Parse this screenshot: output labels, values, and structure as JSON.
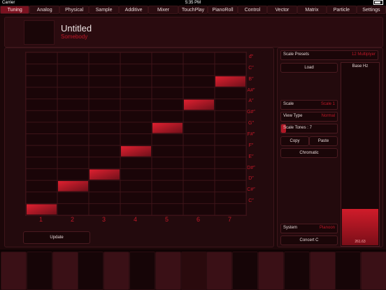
{
  "status": {
    "carrier": "Carrier",
    "time": "5:35 PM"
  },
  "tabs": [
    "Tuning",
    "Analog",
    "Physical",
    "Sample",
    "Additive",
    "Mixer",
    "TouchPlay",
    "PianoRoll",
    "Control",
    "Vector",
    "Matrix",
    "Particle",
    "Settings"
  ],
  "active_tab": "Tuning",
  "preset": {
    "title": "Untitled",
    "author": "Somebody"
  },
  "grid": {
    "x_labels": [
      "1",
      "2",
      "3",
      "4",
      "5",
      "6",
      "7"
    ],
    "note_labels": [
      "đ″",
      "C″",
      "B″",
      "A#″",
      "A″",
      "G#″",
      "G″",
      "F#″",
      "F″",
      "E″",
      "D#″",
      "D″",
      "C#″",
      "C″"
    ],
    "active_steps": [
      {
        "step": 1,
        "row": 13
      },
      {
        "step": 2,
        "row": 11
      },
      {
        "step": 3,
        "row": 10
      },
      {
        "step": 4,
        "row": 8
      },
      {
        "step": 5,
        "row": 6
      },
      {
        "step": 6,
        "row": 4
      },
      {
        "step": 7,
        "row": 2
      }
    ],
    "rows": 14,
    "cols": 7
  },
  "update_label": "Update",
  "right": {
    "scale_presets_label": "Scale Presets",
    "scale_presets_value": "12 Multiplyer",
    "load_label": "Load",
    "base_hz_label": "Base Hz",
    "base_hz_value": "261.63",
    "base_hz_level": 0.2,
    "scale_label": "Scale",
    "scale_value": "Scale 1",
    "view_type_label": "View Type",
    "view_type_value": "Normal",
    "scale_tones_label": "Scale Tones : 7",
    "copy_label": "Copy",
    "paste_label": "Paste",
    "chromatic_label": "Chromatic",
    "system_label": "System",
    "system_value": "Pianoon",
    "concert_label": "Concert C"
  },
  "colors": {
    "accent": "#c01828",
    "active_cell": "#d01c2a",
    "background": "#1c0709"
  }
}
